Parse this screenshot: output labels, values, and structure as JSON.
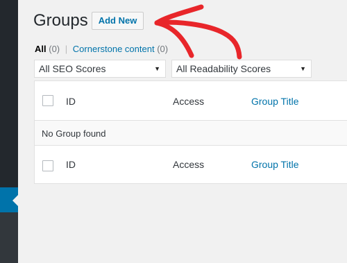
{
  "page": {
    "title": "Groups",
    "add_new_label": "Add New"
  },
  "filters": {
    "all_label": "All",
    "all_count": "(0)",
    "separator": "|",
    "cornerstone_label": "Cornerstone content",
    "cornerstone_count": "(0)"
  },
  "dropdowns": {
    "seo_selected": "All SEO Scores",
    "readability_selected": "All Readability Scores",
    "caret": "▼"
  },
  "table": {
    "columns": [
      "ID",
      "Access",
      "Group Title"
    ],
    "empty_message": "No Group found"
  },
  "annotation": {
    "arrow_color": "#e8262a"
  }
}
